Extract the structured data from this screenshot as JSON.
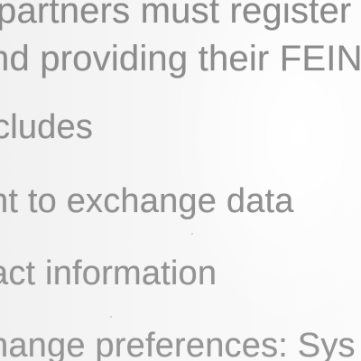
{
  "document": {
    "lines": [
      "partners must register",
      "nd providing their FEIN",
      "cludes",
      "nt to exchange data",
      "act information",
      "nange preferences: Sys"
    ]
  }
}
